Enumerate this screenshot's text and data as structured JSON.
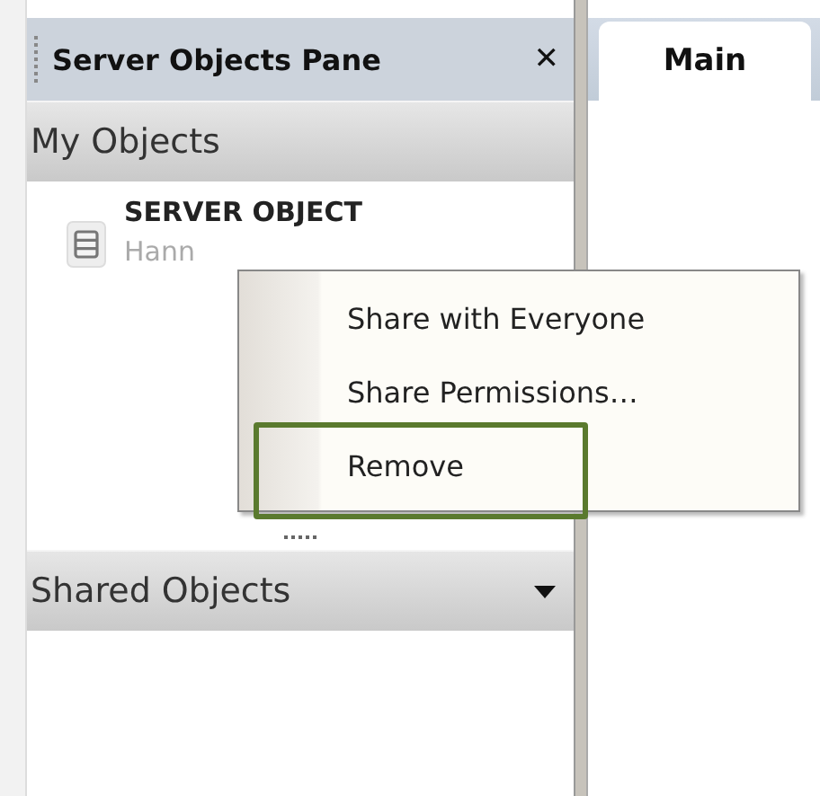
{
  "pane": {
    "title": "Server Objects Pane",
    "close": "✕"
  },
  "sections": [
    {
      "title": "My Objects",
      "expanded": true,
      "items": [
        {
          "name": "SERVER OBJECT",
          "owner": "Hann"
        }
      ]
    },
    {
      "title": "Shared Objects",
      "expanded": false
    }
  ],
  "tabs": [
    {
      "label": "Main",
      "selected": true
    }
  ],
  "context_menu": {
    "items": [
      {
        "label": "Share with Everyone",
        "highlighted": false
      },
      {
        "label": "Share Permissions…",
        "highlighted": false
      },
      {
        "label": "Remove",
        "highlighted": true
      }
    ]
  }
}
